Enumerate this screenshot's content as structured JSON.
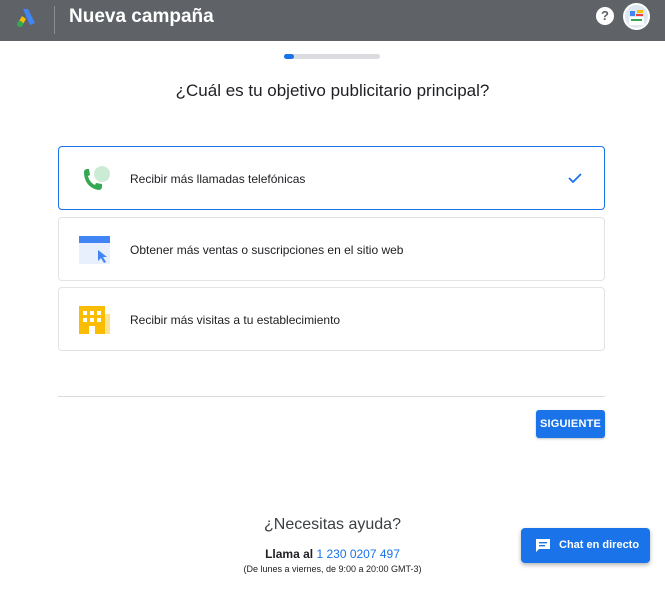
{
  "header": {
    "title": "Nueva campaña",
    "help_symbol": "?",
    "logo_icon": "google-ads-logo",
    "help_icon": "help-icon",
    "avatar_icon": "avatar"
  },
  "progress": {
    "fraction": 0.1
  },
  "question": "¿Cuál es tu objetivo publicitario principal?",
  "options": [
    {
      "label": "Recibir más llamadas telefónicas",
      "icon": "phone-icon",
      "selected": true
    },
    {
      "label": "Obtener más ventas o suscripciones en el sitio web",
      "icon": "website-icon",
      "selected": false
    },
    {
      "label": "Recibir más visitas a tu establecimiento",
      "icon": "store-icon",
      "selected": false
    }
  ],
  "next_button": "SIGUIENTE",
  "help": {
    "title": "¿Necesitas ayuda?",
    "call_prefix": "Llama al",
    "phone": "1 230 0207 497",
    "hours": "(De lunes a viernes, de 9:00 a 20:00 GMT-3)"
  },
  "chat": {
    "label": "Chat en directo",
    "icon": "chat-icon"
  },
  "colors": {
    "header_bg": "#5f6368",
    "accent": "#1a73e8",
    "google_yellow": "#fbbc04",
    "google_green": "#34a853"
  }
}
